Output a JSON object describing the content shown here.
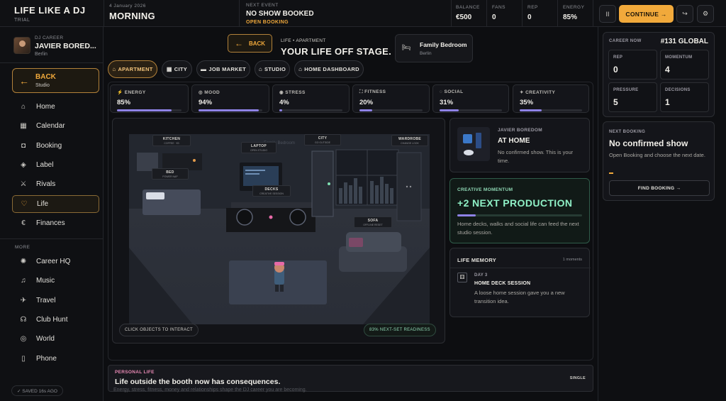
{
  "app": {
    "title": "LIFE LIKE A DJ",
    "mode": "TRIAL"
  },
  "topbar": {
    "date": "4 January 2026",
    "time_of_day": "MORNING",
    "next_event_label": "NEXT EVENT",
    "next_event_title": "NO SHOW BOOKED",
    "next_event_status": "OPEN BOOKING",
    "stats": [
      {
        "label": "BALANCE",
        "value": "€500"
      },
      {
        "label": "FANS",
        "value": "0"
      },
      {
        "label": "REP",
        "value": "0"
      },
      {
        "label": "ENERGY",
        "value": "85%"
      }
    ],
    "pause_label": "II",
    "continue_label": "CONTINUE →",
    "exit_label": "↪",
    "settings_label": "⚙"
  },
  "profile": {
    "label": "DJ CAREER",
    "name": "JAVIER BORED...",
    "location": "Berlin"
  },
  "sidebar": {
    "back_label": "BACK",
    "back_sub": "Studio",
    "items": [
      {
        "label": "Home",
        "icon": "⌂"
      },
      {
        "label": "Calendar",
        "icon": "▦"
      },
      {
        "label": "Booking",
        "icon": "◘"
      },
      {
        "label": "Label",
        "icon": "◈"
      },
      {
        "label": "Rivals",
        "icon": "⚔"
      },
      {
        "label": "Life",
        "icon": "♡"
      },
      {
        "label": "Finances",
        "icon": "€"
      }
    ],
    "more_label": "MORE",
    "more_items": [
      {
        "label": "Career HQ",
        "icon": "✺"
      },
      {
        "label": "Music",
        "icon": "♫"
      },
      {
        "label": "Travel",
        "icon": "✈"
      },
      {
        "label": "Club Hunt",
        "icon": "☊"
      },
      {
        "label": "World",
        "icon": "◎"
      },
      {
        "label": "Phone",
        "icon": "▯"
      }
    ],
    "saved_label": "✓ SAVED 16s AGO"
  },
  "header": {
    "back_label": "BACK",
    "subtitle": "LIFE • APARTMENT",
    "title": "YOUR LIFE OFF STAGE.",
    "location_title": "Family Bedroom",
    "location_sub": "Berlin"
  },
  "tabs": [
    {
      "label": "APARTMENT",
      "icon": "⌂"
    },
    {
      "label": "CITY",
      "icon": "▦"
    },
    {
      "label": "JOB MARKET",
      "icon": "▬"
    },
    {
      "label": "STUDIO",
      "icon": "⌂"
    },
    {
      "label": "HOME DASHBOARD",
      "icon": "⌂"
    }
  ],
  "stat_cards": [
    {
      "label": "ENERGY",
      "icon": "⚡",
      "value": "85%",
      "pct": 85
    },
    {
      "label": "MOOD",
      "icon": "◎",
      "value": "94%",
      "pct": 94
    },
    {
      "label": "STRESS",
      "icon": "◉",
      "value": "4%",
      "pct": 4
    },
    {
      "label": "FITNESS",
      "icon": "⛶",
      "value": "20%",
      "pct": 20
    },
    {
      "label": "SOCIAL",
      "icon": "◌",
      "value": "31%",
      "pct": 31
    },
    {
      "label": "CREATIVITY",
      "icon": "✦",
      "value": "35%",
      "pct": 35
    }
  ],
  "room": {
    "background_text": "Family Bedroom",
    "objects": [
      {
        "title": "KITCHEN",
        "sub": "COFFEE · €3"
      },
      {
        "title": "LAPTOP",
        "sub": "OPEN STUDIO"
      },
      {
        "title": "CITY",
        "sub": "GO OUTSIDE"
      },
      {
        "title": "WARDROBE",
        "sub": "CHANGE LOOK"
      },
      {
        "title": "BED",
        "sub": "POWER NAP"
      },
      {
        "title": "DECKS",
        "sub": "CREATIVE SESSION"
      },
      {
        "title": "SOFA",
        "sub": "OFFLINE RESET"
      }
    ],
    "hint": "CLICK OBJECTS TO INTERACT",
    "readiness": "83% NEXT-SET READINESS"
  },
  "home_card": {
    "label": "JAVIER BOREDOM",
    "title": "AT HOME",
    "text": "No confirmed show. This is your time."
  },
  "momentum_card": {
    "label": "CREATIVE MOMENTUM",
    "title": "+2 NEXT PRODUCTION",
    "progress": 15,
    "text": "Home decks, walks and social life can feed the next studio session."
  },
  "life_memory": {
    "title": "LIFE MEMORY",
    "count": "1 moments",
    "day": "DAY 3",
    "event": "HOME DECK SESSION",
    "text": "A loose home session gave you a new transition idea."
  },
  "personal_life": {
    "label": "PERSONAL LIFE",
    "title": "Life outside the booth now has consequences.",
    "status": "SINGLE",
    "text": "Energy, stress, fitness, money and relationships shape the DJ career you are becoming."
  },
  "career_now": {
    "label": "CAREER NOW",
    "rank": "#131 GLOBAL",
    "metrics": [
      {
        "label": "REP",
        "value": "0"
      },
      {
        "label": "MOMENTUM",
        "value": "4"
      },
      {
        "label": "PRESSURE",
        "value": "5"
      },
      {
        "label": "DECISIONS",
        "value": "1"
      }
    ]
  },
  "next_booking": {
    "label": "NEXT BOOKING",
    "title": "No confirmed show",
    "text": "Open Booking and choose the next date.",
    "button": "FIND BOOKING →"
  },
  "colors": {
    "accent": "#f1a93b",
    "progress": "#8e82e6",
    "momentum": "#8ff0c6",
    "personal": "#e889b4"
  }
}
